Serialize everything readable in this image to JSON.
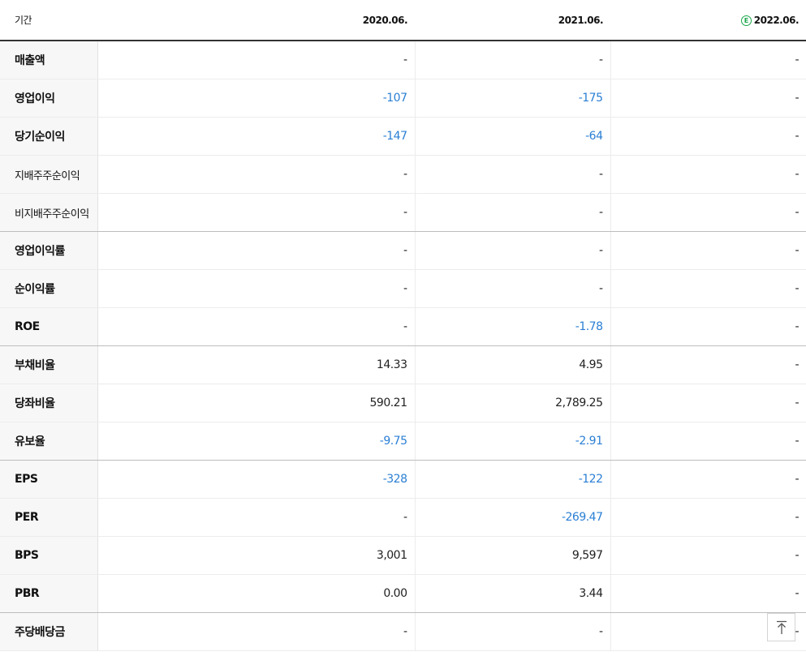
{
  "header": {
    "period_label": "기간",
    "columns": [
      "2020.06.",
      "2021.06.",
      "2022.06."
    ],
    "estimate_badge": "E"
  },
  "rows": [
    {
      "label": "매출액",
      "values": [
        "-",
        "-",
        "-"
      ]
    },
    {
      "label": "영업이익",
      "values": [
        "-107",
        "-175",
        "-"
      ]
    },
    {
      "label": "당기순이익",
      "values": [
        "-147",
        "-64",
        "-"
      ]
    },
    {
      "label": "지배주주순이익",
      "values": [
        "-",
        "-",
        "-"
      ]
    },
    {
      "label": "비지배주주순이익",
      "values": [
        "-",
        "-",
        "-"
      ]
    },
    {
      "label": "영업이익률",
      "values": [
        "-",
        "-",
        "-"
      ]
    },
    {
      "label": "순이익률",
      "values": [
        "-",
        "-",
        "-"
      ]
    },
    {
      "label": "ROE",
      "values": [
        "-",
        "-1.78",
        "-"
      ]
    },
    {
      "label": "부채비율",
      "values": [
        "14.33",
        "4.95",
        "-"
      ]
    },
    {
      "label": "당좌비율",
      "values": [
        "590.21",
        "2,789.25",
        "-"
      ]
    },
    {
      "label": "유보율",
      "values": [
        "-9.75",
        "-2.91",
        "-"
      ]
    },
    {
      "label": "EPS",
      "values": [
        "-328",
        "-122",
        "-"
      ]
    },
    {
      "label": "PER",
      "values": [
        "-",
        "-269.47",
        "-"
      ]
    },
    {
      "label": "BPS",
      "values": [
        "3,001",
        "9,597",
        "-"
      ]
    },
    {
      "label": "PBR",
      "values": [
        "0.00",
        "3.44",
        "-"
      ]
    },
    {
      "label": "주당배당금",
      "values": [
        "-",
        "-",
        "-"
      ]
    }
  ],
  "colors": {
    "negative": "#2a7fd4",
    "estimate": "#1aa64a"
  },
  "scroll_top_icon": "arrow-up-to-line-icon"
}
